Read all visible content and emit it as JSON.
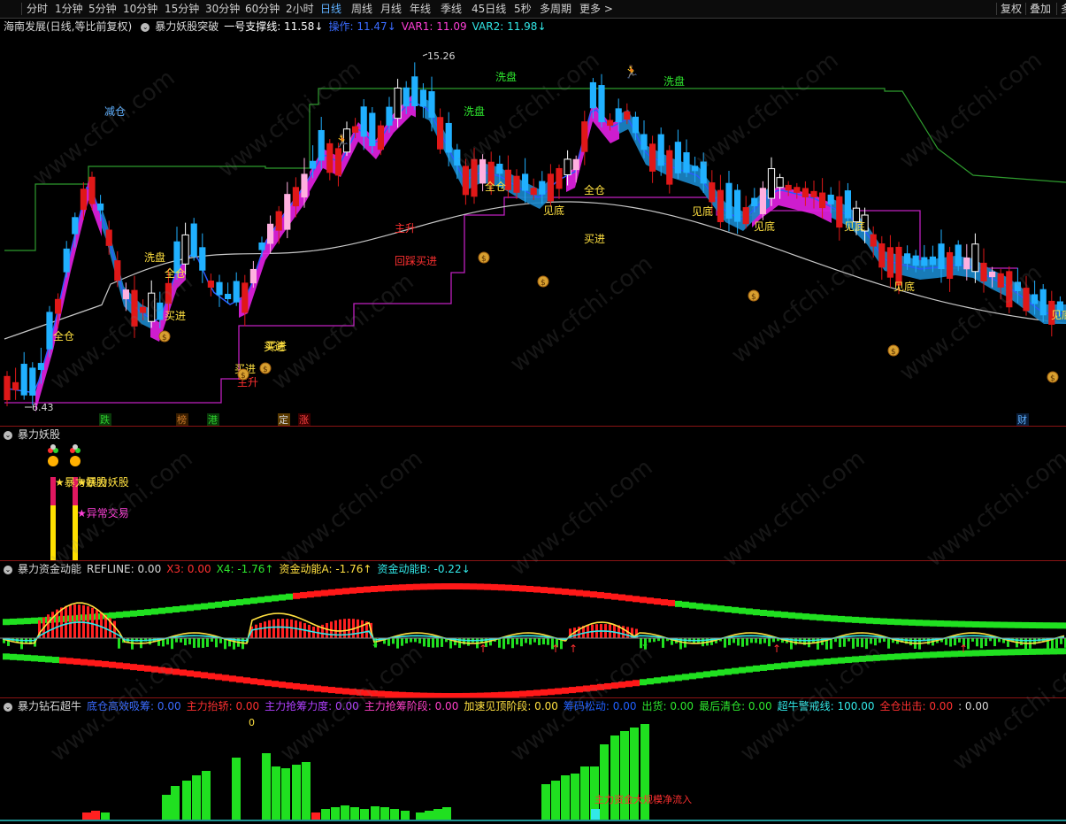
{
  "toolbar": {
    "periods": [
      "分时",
      "1分钟",
      "5分钟",
      "10分钟",
      "15分钟",
      "30分钟",
      "60分钟",
      "2小时",
      "日线",
      "周线",
      "月线",
      "年线",
      "季线",
      "45日线",
      "5秒",
      "多周期",
      "更多 >"
    ],
    "active_period": "日线",
    "right_buttons": [
      "复权",
      "叠加",
      "多"
    ]
  },
  "main_panel": {
    "stock_title": "海南发展(日线,等比前复权)",
    "indicator_name": "暴力妖股突破",
    "items": [
      {
        "label": "一号支撑线: 11.58↓",
        "color": "#ffffff"
      },
      {
        "label": "操作: 11.47↓",
        "color": "#3a6bff"
      },
      {
        "label": "VAR1: 11.09",
        "color": "#ff3fd8"
      },
      {
        "label": "VAR2: 11.98↓",
        "color": "#32e8e8"
      }
    ],
    "high_label": "15.26",
    "low_label": "6.43",
    "signals": [
      "减仓",
      "洗盘",
      "全仓",
      "买进",
      "洗盘",
      "全仓",
      "买进",
      "主升",
      "回踩买进",
      "买进",
      "买进",
      "主升",
      "洗盘",
      "全仓",
      "见底",
      "买进",
      "全仓",
      "见底",
      "洗盘",
      "见底",
      "见底",
      "见底",
      "见底"
    ],
    "bottom_tags": [
      {
        "text": "跌",
        "color": "#2ecf2e",
        "bg": "#0a3a0a"
      },
      {
        "text": "榜",
        "color": "#c87828",
        "bg": "#3a1e00"
      },
      {
        "text": "港",
        "color": "#2ecf2e",
        "bg": "#0a3a0a"
      },
      {
        "text": "定",
        "color": "#d0d0d0",
        "bg": "#5a3a00"
      },
      {
        "text": "涨",
        "color": "#ff4040",
        "bg": "#3a0000"
      },
      {
        "text": "财",
        "color": "#5fb0ff",
        "bg": "#0a1e3a"
      }
    ],
    "watermark": "www.cfchi.com"
  },
  "panel2": {
    "title": "暴力妖股",
    "labels": [
      "★暴力妖股",
      "★暴力妖股",
      "★异常交易"
    ]
  },
  "panel3": {
    "title": "暴力资金动能",
    "items": [
      {
        "label": "REFLINE: 0.00",
        "color": "#d8d8d8"
      },
      {
        "label": "X3: 0.00",
        "color": "#ff3030"
      },
      {
        "label": "X4: -1.76↑",
        "color": "#2ee82e"
      },
      {
        "label": "资金动能A: -1.76↑",
        "color": "#ffe040"
      },
      {
        "label": "资金动能B: -0.22↓",
        "color": "#32e8e8"
      }
    ]
  },
  "panel4": {
    "title": "暴力钻石超牛",
    "items": [
      {
        "label": "底仓高效吸筹: 0.00",
        "color": "#3a6bff"
      },
      {
        "label": "主力抬轿: 0.00",
        "color": "#ff3030"
      },
      {
        "label": "主力抢筹力度: 0.00",
        "color": "#b040ff"
      },
      {
        "label": "主力抢筹阶段: 0.00",
        "color": "#ff40c8"
      },
      {
        "label": "加速见顶阶段: 0.00",
        "color": "#ffe040"
      },
      {
        "label": "筹码松动: 0.00",
        "color": "#2060ff"
      },
      {
        "label": "出货: 0.00",
        "color": "#2ee82e"
      },
      {
        "label": "最后清仓: 0.00",
        "color": "#2ee82e"
      },
      {
        "label": "超牛警戒线: 100.00",
        "color": "#32e8e8"
      },
      {
        "label": "全仓出击: 0.00",
        "color": "#ff3030"
      },
      {
        "label": ": 0.00",
        "color": "#d8d8d8"
      }
    ],
    "zero_label": "0",
    "flow_label": "主力资金大规模净流入"
  }
}
